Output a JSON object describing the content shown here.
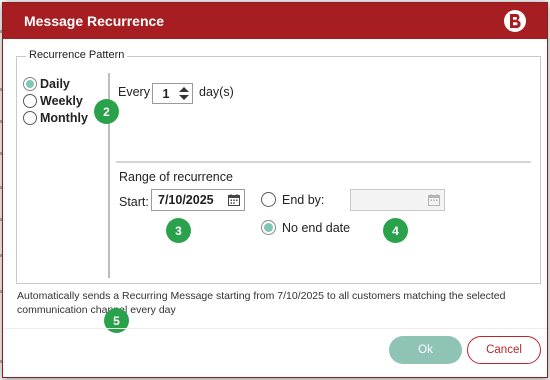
{
  "dialog": {
    "title": "Message Recurrence"
  },
  "pattern": {
    "legend": "Recurrence Pattern",
    "options": [
      {
        "label": "Daily",
        "checked": true
      },
      {
        "label": "Weekly",
        "checked": false
      },
      {
        "label": "Monthly",
        "checked": false
      }
    ],
    "every_label": "Every",
    "every_value": "1",
    "unit_label": "day(s)"
  },
  "range": {
    "title": "Range of recurrence",
    "start_label": "Start:",
    "start_value": "7/10/2025",
    "end_by_label": "End by:",
    "end_by_value": "",
    "no_end_label": "No end date",
    "selected": "no_end_date"
  },
  "badges": [
    "2",
    "3",
    "4",
    "5"
  ],
  "summary": "Automatically sends a Recurring Message starting from 7/10/2025 to all customers matching the selected communication channel every day",
  "buttons": {
    "ok": "Ok",
    "cancel": "Cancel"
  },
  "colors": {
    "titlebar": "#a61e22",
    "accent": "#7fc6b4",
    "ok_button": "#8fc3b6",
    "badge": "#2aa24b"
  },
  "icons": {
    "logo": "brand-b-logo",
    "calendar": "calendar-icon",
    "stepper": "stepper-arrows-icon"
  }
}
